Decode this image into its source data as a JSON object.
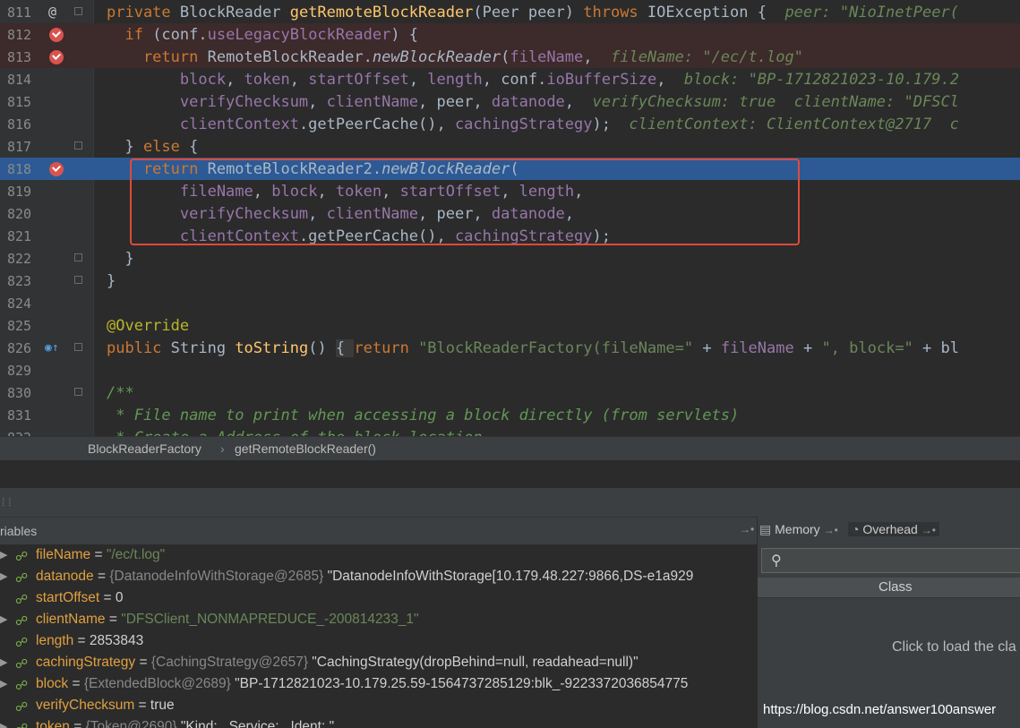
{
  "editor": {
    "lines": [
      {
        "n": "811",
        "parts": [
          [
            "kw",
            "private "
          ],
          [
            "",
            "BlockReader "
          ],
          [
            "fn",
            "getRemoteBlockReader"
          ],
          [
            "",
            "(Peer peer) "
          ],
          [
            "kw",
            "throws "
          ],
          [
            "",
            "IOException {  "
          ],
          [
            "hint",
            "peer: \"NioInetPeer("
          ]
        ]
      },
      {
        "n": "812",
        "parts": [
          [
            "kw",
            "  if "
          ],
          [
            "",
            "(conf."
          ],
          [
            "fld",
            "useLegacyBlockReader"
          ],
          [
            "",
            ") {"
          ]
        ]
      },
      {
        "n": "813",
        "parts": [
          [
            "kw",
            "    return "
          ],
          [
            "",
            "RemoteBlockReader."
          ],
          [
            "it",
            "newBlockReader"
          ],
          [
            "",
            "("
          ],
          [
            "fld",
            "fileName"
          ],
          [
            "",
            ",  "
          ],
          [
            "hint",
            "fileName: \"/ec/t.log\""
          ]
        ]
      },
      {
        "n": "814",
        "parts": [
          [
            "fld",
            "        block"
          ],
          [
            "",
            ", "
          ],
          [
            "fld",
            "token"
          ],
          [
            "",
            ", "
          ],
          [
            "fld",
            "startOffset"
          ],
          [
            "",
            ", "
          ],
          [
            "fld",
            "length"
          ],
          [
            "",
            ", conf."
          ],
          [
            "fld",
            "ioBufferSize"
          ],
          [
            "",
            ",  "
          ],
          [
            "hint",
            "block: \"BP-1712821023-10.179.2"
          ]
        ]
      },
      {
        "n": "815",
        "parts": [
          [
            "fld",
            "        verifyChecksum"
          ],
          [
            "",
            ", "
          ],
          [
            "fld",
            "clientName"
          ],
          [
            "",
            ", peer, "
          ],
          [
            "fld",
            "datanode"
          ],
          [
            "",
            ",  "
          ],
          [
            "hint",
            "verifyChecksum: true  clientName: \"DFSCl"
          ]
        ]
      },
      {
        "n": "816",
        "parts": [
          [
            "fld",
            "        clientContext"
          ],
          [
            "",
            ".getPeerCache(), "
          ],
          [
            "fld",
            "cachingStrategy"
          ],
          [
            "",
            ");  "
          ],
          [
            "hint",
            "clientContext: ClientContext@2717  c"
          ]
        ]
      },
      {
        "n": "817",
        "parts": [
          [
            "",
            "  } "
          ],
          [
            "kw",
            "else "
          ],
          [
            "",
            "{"
          ]
        ]
      },
      {
        "n": "818",
        "parts": [
          [
            "kw",
            "    return "
          ],
          [
            "",
            "RemoteBlockReader2."
          ],
          [
            "it",
            "newBlockReader"
          ],
          [
            "",
            "("
          ]
        ]
      },
      {
        "n": "819",
        "parts": [
          [
            "fld",
            "        fileName"
          ],
          [
            "",
            ", "
          ],
          [
            "fld",
            "block"
          ],
          [
            "",
            ", "
          ],
          [
            "fld",
            "token"
          ],
          [
            "",
            ", "
          ],
          [
            "fld",
            "startOffset"
          ],
          [
            "",
            ", "
          ],
          [
            "fld",
            "length"
          ],
          [
            "",
            ","
          ]
        ]
      },
      {
        "n": "820",
        "parts": [
          [
            "fld",
            "        verifyChecksum"
          ],
          [
            "",
            ", "
          ],
          [
            "fld",
            "clientName"
          ],
          [
            "",
            ", peer, "
          ],
          [
            "fld",
            "datanode"
          ],
          [
            "",
            ","
          ]
        ]
      },
      {
        "n": "821",
        "parts": [
          [
            "fld",
            "        clientContext"
          ],
          [
            "",
            ".getPeerCache(), "
          ],
          [
            "fld",
            "cachingStrategy"
          ],
          [
            "",
            ");"
          ]
        ]
      },
      {
        "n": "822",
        "parts": [
          [
            "",
            "  }"
          ]
        ]
      },
      {
        "n": "823",
        "parts": [
          [
            "",
            "}"
          ]
        ]
      },
      {
        "n": "824",
        "parts": []
      },
      {
        "n": "825",
        "parts": [
          [
            "ann",
            "@Override"
          ]
        ]
      },
      {
        "n": "826",
        "parts": [
          [
            "kw",
            "public "
          ],
          [
            "",
            "String "
          ],
          [
            "fn",
            "toString"
          ],
          [
            "",
            "() "
          ],
          [
            "br",
            "{ "
          ],
          [
            "kw",
            "return "
          ],
          [
            "str",
            "\"BlockReaderFactory(fileName=\""
          ],
          [
            "",
            " + "
          ],
          [
            "fld",
            "fileName"
          ],
          [
            "",
            " + "
          ],
          [
            "str",
            "\", block=\""
          ],
          [
            "",
            " + bl"
          ]
        ]
      },
      {
        "n": "829",
        "parts": []
      },
      {
        "n": "830",
        "parts": [
          [
            "cm",
            "/**"
          ]
        ]
      },
      {
        "n": "831",
        "parts": [
          [
            "cm",
            " * File name to print when accessing a block directly (from servlets)"
          ]
        ]
      },
      {
        "n": "832",
        "parts": [
          [
            "cm",
            " * Create a Address of the block location"
          ]
        ]
      }
    ]
  },
  "breadcrumb": {
    "class_name": "BlockReaderFactory",
    "sep": "›",
    "method": "getRemoteBlockReader()"
  },
  "variables": {
    "header": "riables",
    "pin": "→•",
    "rows": [
      {
        "name": "fileName",
        "eq": " = ",
        "ref": "",
        "val": "\"/ec/t.log\"",
        "vtype": "str",
        "arrow": "▶"
      },
      {
        "name": "datanode",
        "eq": " = ",
        "ref": "{DatanodeInfoWithStorage@2685} ",
        "val": "\"DatanodeInfoWithStorage[10.179.48.227:9866,DS-e1a929",
        "vtype": "plain",
        "arrow": "▶"
      },
      {
        "name": "startOffset",
        "eq": " = ",
        "ref": "",
        "val": "0",
        "vtype": "plain",
        "arrow": ""
      },
      {
        "name": "clientName",
        "eq": " = ",
        "ref": "",
        "val": "\"DFSClient_NONMAPREDUCE_-200814233_1\"",
        "vtype": "str",
        "arrow": "▶"
      },
      {
        "name": "length",
        "eq": " = ",
        "ref": "",
        "val": "2853843",
        "vtype": "plain",
        "arrow": ""
      },
      {
        "name": "cachingStrategy",
        "eq": " = ",
        "ref": "{CachingStrategy@2657} ",
        "val": "\"CachingStrategy(dropBehind=null, readahead=null)\"",
        "vtype": "plain",
        "arrow": "▶"
      },
      {
        "name": "block",
        "eq": " = ",
        "ref": "{ExtendedBlock@2689} ",
        "val": "\"BP-1712821023-10.179.25.59-1564737285129:blk_-9223372036854775",
        "vtype": "plain",
        "arrow": "▶"
      },
      {
        "name": "verifyChecksum",
        "eq": " = ",
        "ref": "",
        "val": "true",
        "vtype": "plain",
        "arrow": ""
      },
      {
        "name": "token",
        "eq": " = ",
        "ref": "{Token@2690} ",
        "val": "\"Kind: , Service: , Ident: \"",
        "vtype": "plain",
        "arrow": "▶"
      }
    ]
  },
  "memory_panel": {
    "tab_memory": "Memory",
    "tab_memory_pin": "→•",
    "tab_overhead": "Overhead",
    "tab_overhead_pin": "→•",
    "search_placeholder": "",
    "column_header": "Class",
    "click_to_load": "Click to load the cla"
  },
  "watermark": "https://blog.csdn.net/answer100answer",
  "colors": {
    "background": "#2b2b2b",
    "keyword": "#cc7832",
    "string": "#6a8759",
    "field": "#9876aa",
    "function": "#ffc66d",
    "exec_line": "#2d5a94",
    "highlight_box": "#e04a3a"
  }
}
